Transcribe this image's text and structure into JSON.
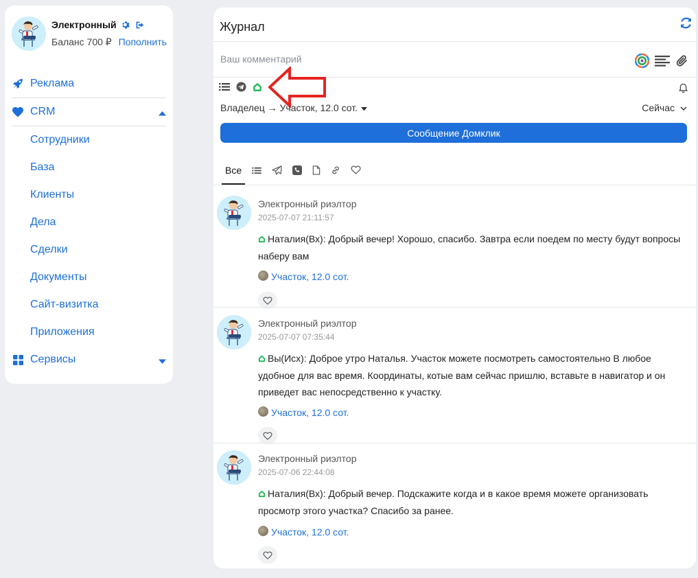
{
  "profile": {
    "name": "Электронный",
    "balance": "Баланс 700 ₽",
    "topup_label": "Пополнить"
  },
  "nav": {
    "ads": "Реклама",
    "crm": "CRM",
    "crm_items": [
      "Сотрудники",
      "База",
      "Клиенты",
      "Дела",
      "Сделки",
      "Документы",
      "Сайт-визитка",
      "Приложения"
    ],
    "services": "Сервисы"
  },
  "journal": {
    "title": "Журнал",
    "comment_placeholder": "Ваш комментарий",
    "owner_route": "Владелец → Участок, 12.0 сот.",
    "when": "Сейчас",
    "send_button": "Сообщение Домклик",
    "tab_all": "Все"
  },
  "entries": [
    {
      "author": "Электронный риэлтор",
      "time": "2025-07-07 21:11:57",
      "message": "Наталия(Вх): Добрый вечер! Хорошо, спасибо.  Завтра если поедем по месту будут вопросы наберу вам",
      "link": "Участок, 12.0 сот."
    },
    {
      "author": "Электронный риэлтор",
      "time": "2025-07-07 07:35:44",
      "message": "Вы(Исх): Доброе утро Наталья. Участок можете посмотреть самостоятельно В любое удобное для вас время. Координаты, котые вам сейчас пришлю, вставьте в навигатор и он приведет вас непосредственно к участку.",
      "link": "Участок, 12.0 сот."
    },
    {
      "author": "Электронный риэлтор",
      "time": "2025-07-06 22:44:08",
      "message": "Наталия(Вх): Добрый вечер. Подскажите когда и в какое время можете организовать просмотр этого участка? Спасибо за ранее.",
      "link": "Участок, 12.0 сот."
    }
  ],
  "colors": {
    "accent": "#1e6fd9",
    "page_bg": "#eceef1",
    "annotation_arrow": "#e52421",
    "domclick_green": "#1db954"
  }
}
